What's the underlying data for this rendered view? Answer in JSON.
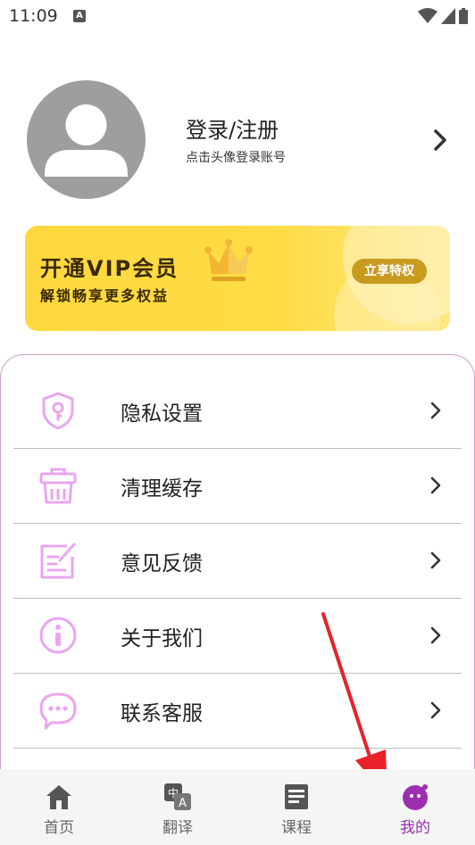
{
  "status_bar": {
    "time": "11:09",
    "notification_letter": "A"
  },
  "profile": {
    "title": "登录/注册",
    "subtitle": "点击头像登录账号"
  },
  "vip": {
    "title": "开通VIP会员",
    "subtitle": "解锁畅享更多权益",
    "button_label": "立享特权"
  },
  "menu": {
    "items": [
      {
        "label": "隐私设置",
        "icon": "shield-key-icon"
      },
      {
        "label": "清理缓存",
        "icon": "trash-bin-icon"
      },
      {
        "label": "意见反馈",
        "icon": "feedback-edit-icon"
      },
      {
        "label": "关于我们",
        "icon": "info-icon"
      },
      {
        "label": "联系客服",
        "icon": "chat-bubble-icon"
      }
    ]
  },
  "nav": {
    "items": [
      {
        "label": "首页",
        "icon": "home-icon"
      },
      {
        "label": "翻译",
        "icon": "translate-icon"
      },
      {
        "label": "课程",
        "icon": "course-icon"
      },
      {
        "label": "我的",
        "icon": "profile-face-icon"
      }
    ],
    "active_index": 3
  },
  "colors": {
    "accent_purple": "#9b2fb0",
    "icon_pink": "#e9a6ee",
    "vip_yellow": "#ffd83d",
    "vip_button": "#c89a1e",
    "annotation_red": "#e8212a"
  }
}
